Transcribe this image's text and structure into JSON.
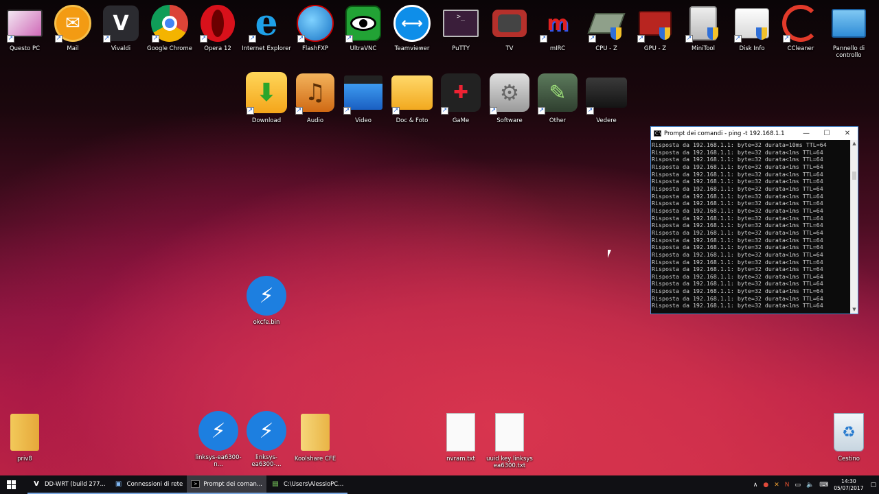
{
  "desktop": {
    "top_row": [
      {
        "label": "Questo PC"
      },
      {
        "label": "Mail"
      },
      {
        "label": "Vivaldi"
      },
      {
        "label": "Google Chrome"
      },
      {
        "label": "Opera 12"
      },
      {
        "label": "Internet Explorer"
      },
      {
        "label": "FlashFXP"
      },
      {
        "label": "UltraVNC"
      },
      {
        "label": "Teamviewer"
      },
      {
        "label": "PuTTY"
      },
      {
        "label": "TV"
      },
      {
        "label": "mIRC"
      },
      {
        "label": "CPU - Z"
      },
      {
        "label": "GPU - Z"
      },
      {
        "label": "MiniTool"
      },
      {
        "label": "Disk Info"
      },
      {
        "label": "CCleaner"
      },
      {
        "label": "Pannello di controllo"
      }
    ],
    "second_row": [
      {
        "label": "Download"
      },
      {
        "label": "Audio"
      },
      {
        "label": "Video"
      },
      {
        "label": "Doc & Foto"
      },
      {
        "label": "GaMe"
      },
      {
        "label": "Software"
      },
      {
        "label": "Other"
      },
      {
        "label": "Vedere"
      }
    ],
    "middle_icon": {
      "label": "okcfe.bin"
    },
    "bottom_row": [
      {
        "label": "priv8"
      },
      {
        "label": "linksys-ea6300-n..."
      },
      {
        "label": "linksys-ea6300-..."
      },
      {
        "label": "Koolshare CFE"
      },
      {
        "label": "nvram.txt"
      },
      {
        "label": "uuid key linksys ea6300.txt"
      },
      {
        "label": "Cestino"
      }
    ]
  },
  "cmd_window": {
    "title": "Prompt dei comandi - ping -t 192.168.1.1",
    "lines": [
      "Risposta da 192.168.1.1: byte=32 durata=10ms TTL=64",
      "Risposta da 192.168.1.1: byte=32 durata<1ms TTL=64",
      "Risposta da 192.168.1.1: byte=32 durata<1ms TTL=64",
      "Risposta da 192.168.1.1: byte=32 durata<1ms TTL=64",
      "Risposta da 192.168.1.1: byte=32 durata<1ms TTL=64",
      "Risposta da 192.168.1.1: byte=32 durata<1ms TTL=64",
      "Risposta da 192.168.1.1: byte=32 durata<1ms TTL=64",
      "Risposta da 192.168.1.1: byte=32 durata<1ms TTL=64",
      "Risposta da 192.168.1.1: byte=32 durata<1ms TTL=64",
      "Risposta da 192.168.1.1: byte=32 durata<1ms TTL=64",
      "Risposta da 192.168.1.1: byte=32 durata<1ms TTL=64",
      "Risposta da 192.168.1.1: byte=32 durata<1ms TTL=64",
      "Risposta da 192.168.1.1: byte=32 durata<1ms TTL=64",
      "Risposta da 192.168.1.1: byte=32 durata<1ms TTL=64",
      "Risposta da 192.168.1.1: byte=32 durata<1ms TTL=64",
      "Risposta da 192.168.1.1: byte=32 durata<1ms TTL=64",
      "Risposta da 192.168.1.1: byte=32 durata<1ms TTL=64",
      "Risposta da 192.168.1.1: byte=32 durata<1ms TTL=64",
      "Risposta da 192.168.1.1: byte=32 durata<1ms TTL=64",
      "Risposta da 192.168.1.1: byte=32 durata<1ms TTL=64",
      "Risposta da 192.168.1.1: byte=32 durata<1ms TTL=64",
      "Risposta da 192.168.1.1: byte=32 durata<1ms TTL=64",
      "Risposta da 192.168.1.1: byte=32 durata<1ms TTL=64"
    ],
    "minimize": "—",
    "maximize": "☐",
    "close": "✕"
  },
  "taskbar": {
    "tasks": [
      {
        "label": "DD-WRT (build 277..."
      },
      {
        "label": "Connessioni di rete"
      },
      {
        "label": "Prompt dei coman..."
      },
      {
        "label": "C:\\Users\\AlessioPC..."
      }
    ],
    "time": "14:30",
    "date": "05/07/2017"
  }
}
